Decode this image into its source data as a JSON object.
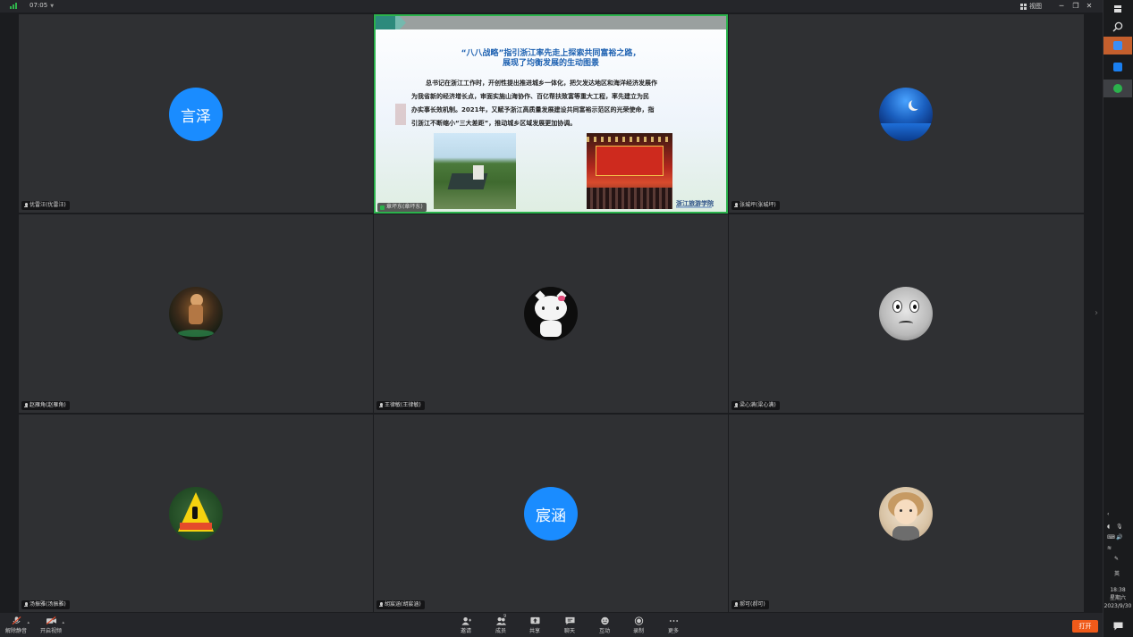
{
  "topbar": {
    "time": "07:05",
    "view_label": "视图",
    "window_buttons": [
      "minimize-icon",
      "restore-icon",
      "close-icon"
    ]
  },
  "participants": [
    {
      "name": "优雷汪(优雷汪)",
      "avatar_text": "言泽",
      "avatar_type": "text"
    },
    {
      "name": "章坏东(章坏东)",
      "avatar_type": "screen-share"
    },
    {
      "name": "张城坪(张城坪)",
      "avatar_type": "image",
      "avatar_icon": "moon-sea-avatar"
    },
    {
      "name": "赵雁角(赵雁角)",
      "avatar_type": "image",
      "avatar_icon": "dancer-avatar"
    },
    {
      "name": "王律敏(王律敏)",
      "avatar_type": "image",
      "avatar_icon": "hello-kitty-avatar"
    },
    {
      "name": "梁心满(梁心满)",
      "avatar_type": "image",
      "avatar_icon": "train-face-avatar"
    },
    {
      "name": "汤振雅(汤振雅)",
      "avatar_type": "image",
      "avatar_icon": "pedestrian-sign-avatar"
    },
    {
      "name": "胡宸涵(胡宸涵)",
      "avatar_text": "宸涵",
      "avatar_type": "text"
    },
    {
      "name": "郝可(郝可)",
      "avatar_type": "image",
      "avatar_icon": "girl-avatar"
    }
  ],
  "slide": {
    "title_line1": "“八八战略”指引浙江率先走上探索共同富裕之路，",
    "title_line2": "展现了均衡发展的生动图景",
    "body_lines": [
      "总书记在浙江工作时，开创性提出推进城乡一体化，把欠发达地区和海洋经济发展作",
      "为我省新的经济增长点，审面实施山海协作、百亿帮扶致富等重大工程，率先建立为民",
      "办实事长效机制。2021年，又赋予浙江高质量发展建设共同富裕示范区的光荣使命，指",
      "引浙江不断缩小“三大差距”，推动城乡区域发展更加协调。"
    ],
    "school_logo": "浙江旅游学院"
  },
  "toolbar": {
    "mute_label": "解除静音",
    "video_label": "开启视频",
    "invite_label": "邀请",
    "members_label": "成员",
    "members_count": "9",
    "share_label": "共享",
    "chat_label": "聊天",
    "react_label": "互动",
    "record_label": "录制",
    "more_label": "更多",
    "open_label": "打开"
  },
  "sidebar": {
    "clock_time": "18:38",
    "weekday": "星期六",
    "date": "2023/9/30",
    "ime_label": "英"
  },
  "colors": {
    "accent_blue": "#1a8cff",
    "active_green": "#2bb24c",
    "open_orange": "#f05a1a",
    "cell_bg": "#2f3033"
  }
}
